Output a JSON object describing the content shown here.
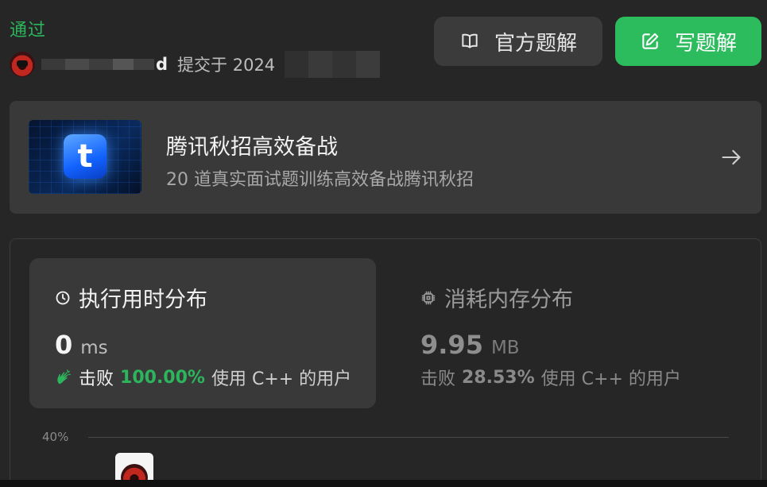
{
  "status": "通过",
  "submission": {
    "username_tail": "d",
    "submitted_prefix": "提交于 2024"
  },
  "buttons": {
    "official_solution": "官方题解",
    "write_solution": "写题解"
  },
  "promo": {
    "title": "腾讯秋招高效备战",
    "subtitle": "20 道真实面试题训练高效备战腾讯秋招",
    "logo_char": "t"
  },
  "runtime": {
    "title": "执行用时分布",
    "value": "0",
    "unit": "ms",
    "beats_label": "击败",
    "beats_pct": "100.00%",
    "beats_tail": "使用 C++ 的用户"
  },
  "memory": {
    "title": "消耗内存分布",
    "value": "9.95",
    "unit": "MB",
    "beats_label": "击败",
    "beats_pct": "28.53%",
    "beats_tail": "使用 C++ 的用户"
  },
  "chart": {
    "y_tick": "40%"
  },
  "colors": {
    "accent_green": "#2cbb5d",
    "background": "#262626",
    "card": "#393939"
  }
}
